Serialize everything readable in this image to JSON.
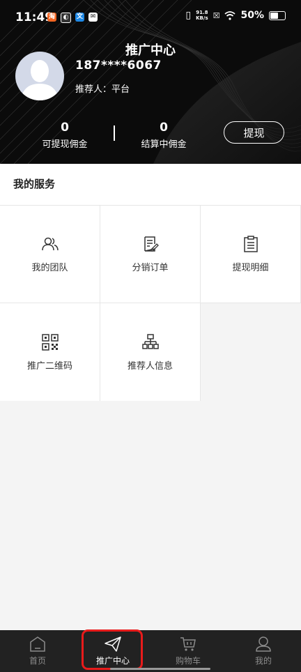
{
  "status_bar": {
    "time": "11:49",
    "net_speed_value": "91.8",
    "net_speed_unit": "KB/s",
    "battery": "50%"
  },
  "header": {
    "title": "推广中心",
    "phone": "187****6067",
    "referrer": "推荐人：平台",
    "stats": [
      {
        "value": "0",
        "label": "可提现佣金"
      },
      {
        "value": "0",
        "label": "结算中佣金"
      }
    ],
    "withdraw_label": "提现"
  },
  "services": {
    "title": "我的服务",
    "items": [
      {
        "label": "我的团队",
        "icon": "team-icon"
      },
      {
        "label": "分销订单",
        "icon": "order-edit-icon"
      },
      {
        "label": "提现明细",
        "icon": "clipboard-icon"
      },
      {
        "label": "推广二维码",
        "icon": "qr-code-icon"
      },
      {
        "label": "推荐人信息",
        "icon": "org-chart-icon"
      }
    ]
  },
  "tabbar": {
    "items": [
      {
        "label": "首页",
        "icon": "home-icon",
        "active": false
      },
      {
        "label": "推广中心",
        "icon": "paper-plane-icon",
        "active": true
      },
      {
        "label": "购物车",
        "icon": "cart-icon",
        "active": false
      },
      {
        "label": "我的",
        "icon": "user-icon",
        "active": false
      }
    ]
  },
  "colors": {
    "header_bg": "#0b0b0b",
    "tabbar_bg": "#222222",
    "highlight": "#e81b1b",
    "avatar_bg": "#d3d9e8"
  }
}
